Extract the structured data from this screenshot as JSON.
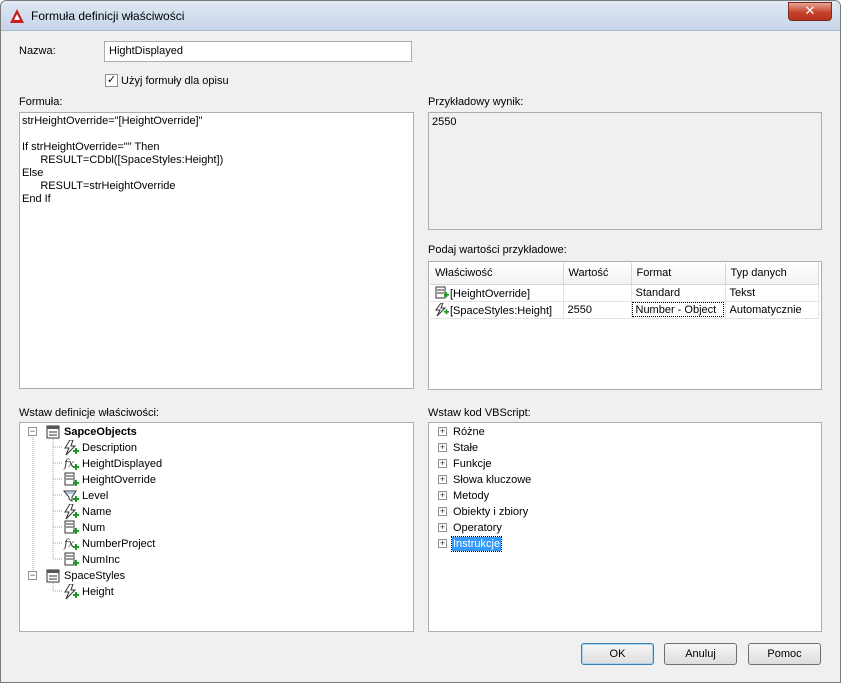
{
  "window": {
    "title": "Formuła definicji właściwości",
    "close_glyph": "✕"
  },
  "name_field": {
    "label": "Nazwa:",
    "value": "HightDisplayed"
  },
  "description_checkbox": {
    "label": "Użyj formuły dla opisu",
    "checked": true,
    "check_glyph": "✓"
  },
  "formula": {
    "label": "Formuła:",
    "lines": [
      "strHeightOverride=\"[HeightOverride]\"",
      "",
      "If strHeightOverride=\"\" Then",
      "      RESULT=CDbl([SpaceStyles:Height])",
      "Else",
      "      RESULT=strHeightOverride",
      "End If"
    ]
  },
  "sample_result": {
    "label": "Przykładowy wynik:",
    "value": "2550"
  },
  "sample_values": {
    "label": "Podaj wartości przykładowe:",
    "columns": [
      "Właściwość",
      "Wartość",
      "Format",
      "Typ danych"
    ],
    "rows": [
      {
        "property": "[HeightOverride]",
        "value": "",
        "format": "Standard",
        "type": "Tekst",
        "icon": "manual-property-icon"
      },
      {
        "property": "[SpaceStyles:Height]",
        "value": "2550",
        "format": "Number - Object",
        "type": "Automatycznie",
        "icon": "automatic-property-icon"
      }
    ]
  },
  "insert_property": {
    "label": "Wstaw definicje właściwości:",
    "tree": [
      {
        "text": "SapceObjects",
        "level": 0,
        "bold": true,
        "expander": "−",
        "icon": "property-set-icon"
      },
      {
        "text": "Description",
        "level": 1,
        "icon": "automatic-property-icon"
      },
      {
        "text": "HeightDisplayed",
        "level": 1,
        "icon": "formula-property-icon"
      },
      {
        "text": "HeightOverride",
        "level": 1,
        "icon": "manual-property-icon"
      },
      {
        "text": "Level",
        "level": 1,
        "icon": "location-property-icon"
      },
      {
        "text": "Name",
        "level": 1,
        "icon": "automatic-property-icon"
      },
      {
        "text": "Num",
        "level": 1,
        "icon": "manual-property-icon"
      },
      {
        "text": "NumberProject",
        "level": 1,
        "icon": "formula-property-icon"
      },
      {
        "text": "NumInc",
        "level": 1,
        "icon": "manual-property-icon"
      },
      {
        "text": "SpaceStyles",
        "level": 0,
        "bold": false,
        "expander": "−",
        "icon": "property-set-icon"
      },
      {
        "text": "Height",
        "level": 1,
        "icon": "automatic-property-icon"
      }
    ]
  },
  "insert_vbscript": {
    "label": "Wstaw kod VBScript:",
    "items": [
      {
        "text": "Różne",
        "expander": "+"
      },
      {
        "text": "Stałe",
        "expander": "+"
      },
      {
        "text": "Funkcje",
        "expander": "+"
      },
      {
        "text": "Słowa kluczowe",
        "expander": "+"
      },
      {
        "text": "Metody",
        "expander": "+"
      },
      {
        "text": "Obiekty i zbiory",
        "expander": "+"
      },
      {
        "text": "Operatory",
        "expander": "+"
      },
      {
        "text": "Instrukcje",
        "expander": "+",
        "selected": true
      }
    ]
  },
  "buttons": {
    "ok": "OK",
    "cancel": "Anuluj",
    "help": "Pomoc"
  },
  "colors": {
    "selection": "#3399ff",
    "autocad_red": "#c8201f",
    "icon_green": "#1a9b1a"
  }
}
